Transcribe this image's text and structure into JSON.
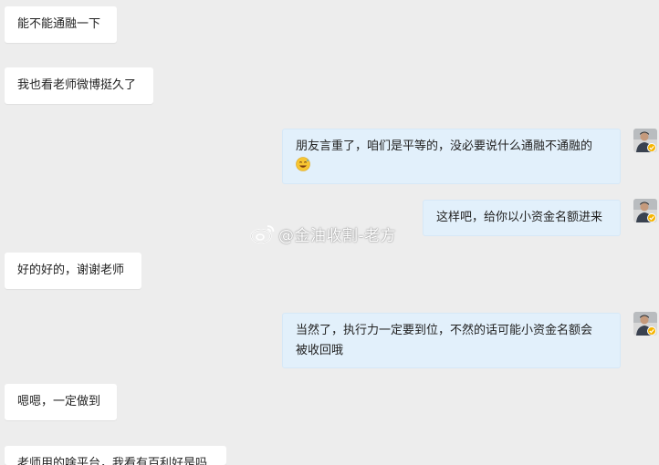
{
  "messages": [
    {
      "side": "left",
      "text": "能不能通融一下"
    },
    {
      "side": "left",
      "text": "我也看老师微博挺久了"
    },
    {
      "side": "right",
      "line1": "朋友言重了，咱们是平等的，没必要说什么通融不通融的",
      "emoji": "grinning-sweat-emoji"
    },
    {
      "side": "right",
      "text": "这样吧，给你以小资金名额进来"
    },
    {
      "side": "left",
      "text": "好的好的，谢谢老师"
    },
    {
      "side": "right",
      "line1": "当然了，执行力一定要到位，不然的话可能小资金名额会",
      "line2": "被收回哦"
    },
    {
      "side": "left",
      "text": "嗯嗯，一定做到"
    },
    {
      "side": "left",
      "text": "老师用的啥平台，我看有百利好是吗"
    }
  ],
  "watermark": {
    "text": "@金油收割-老方",
    "icon": "weibo-icon"
  },
  "colors": {
    "background": "#ededed",
    "left_bubble": "#ffffff",
    "right_bubble": "#e2f0fb",
    "badge": "#f5b400"
  }
}
